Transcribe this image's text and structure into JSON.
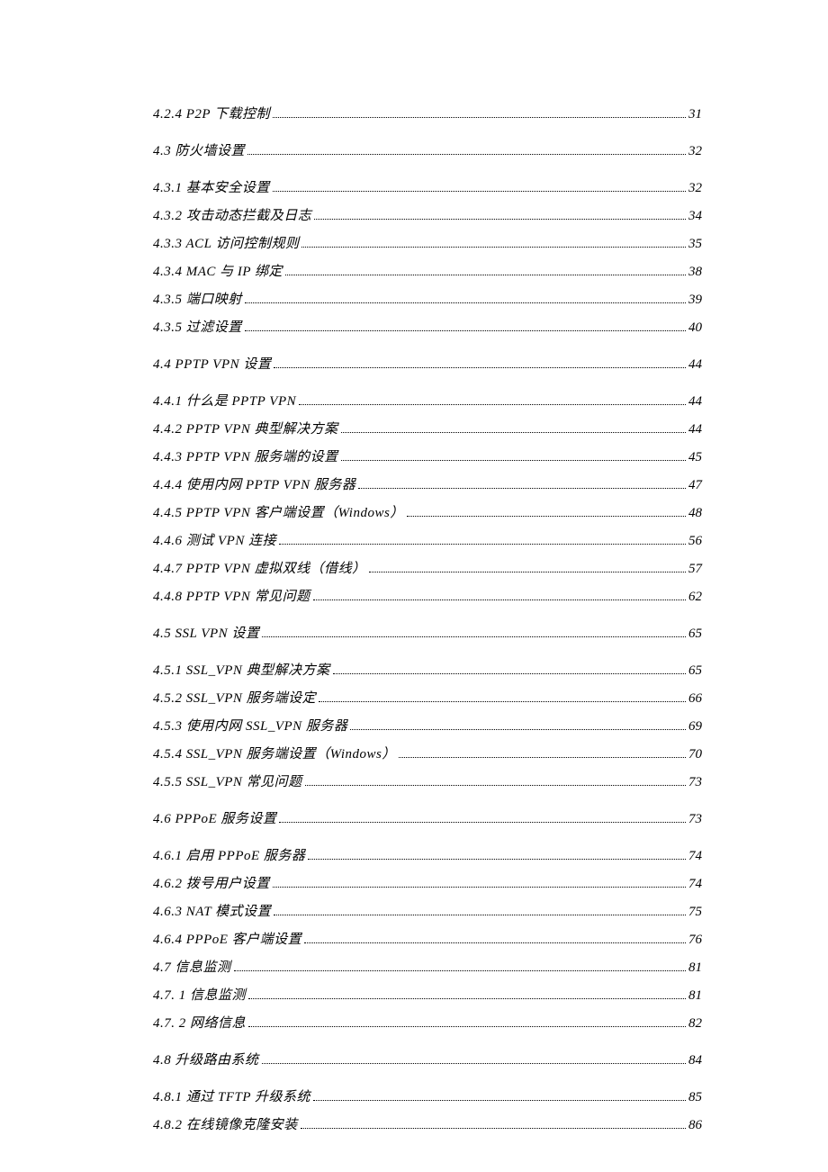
{
  "toc": [
    {
      "label": "4.2.4 P2P 下载控制",
      "page": "31",
      "gapAfter": "group"
    },
    {
      "label": "4.3  防火墙设置",
      "page": "32",
      "gapAfter": "group"
    },
    {
      "label": "4.3.1 基本安全设置",
      "page": "32",
      "gapAfter": "line"
    },
    {
      "label": "4.3.2 攻击动态拦截及日志",
      "page": "34",
      "gapAfter": "line"
    },
    {
      "label": "4.3.3 ACL 访问控制规则",
      "page": "35",
      "gapAfter": "line"
    },
    {
      "label": "4.3.4 MAC 与 IP 绑定",
      "page": "38",
      "gapAfter": "line"
    },
    {
      "label": "4.3.5 端口映射",
      "page": "39",
      "gapAfter": "line"
    },
    {
      "label": "4.3.5 过滤设置",
      "page": "40",
      "gapAfter": "group"
    },
    {
      "label": "4.4  PPTP VPN 设置",
      "page": "44",
      "gapAfter": "group"
    },
    {
      "label": "4.4.1 什么是 PPTP VPN",
      "page": "44",
      "gapAfter": "line"
    },
    {
      "label": "4.4.2 PPTP VPN 典型解决方案",
      "page": "44",
      "gapAfter": "line"
    },
    {
      "label": "4.4.3 PPTP VPN 服务端的设置",
      "page": "45",
      "gapAfter": "line"
    },
    {
      "label": "4.4.4 使用内网 PPTP VPN 服务器",
      "page": "47",
      "gapAfter": "line"
    },
    {
      "label": "4.4.5 PPTP VPN 客户端设置（Windows）",
      "page": "48",
      "gapAfter": "line"
    },
    {
      "label": "4.4.6 测试 VPN 连接",
      "page": "56",
      "gapAfter": "line"
    },
    {
      "label": "4.4.7 PPTP VPN 虚拟双线（借线）",
      "page": "57",
      "gapAfter": "line"
    },
    {
      "label": "4.4.8 PPTP VPN 常见问题",
      "page": "62",
      "gapAfter": "group"
    },
    {
      "label": "4.5  SSL VPN 设置",
      "page": "65",
      "gapAfter": "group"
    },
    {
      "label": "4.5.1 SSL_VPN 典型解决方案",
      "page": "65",
      "gapAfter": "line"
    },
    {
      "label": "4.5.2 SSL_VPN 服务端设定",
      "page": "66",
      "gapAfter": "line"
    },
    {
      "label": "4.5.3 使用内网 SSL_VPN 服务器",
      "page": "69",
      "gapAfter": "line"
    },
    {
      "label": "4.5.4 SSL_VPN 服务端设置（Windows）",
      "page": "70",
      "gapAfter": "line"
    },
    {
      "label": "4.5.5 SSL_VPN 常见问题",
      "page": "73",
      "gapAfter": "group"
    },
    {
      "label": "4.6  PPPoE 服务设置",
      "page": "73",
      "gapAfter": "group"
    },
    {
      "label": "4.6.1 启用 PPPoE 服务器",
      "page": "74",
      "gapAfter": "line"
    },
    {
      "label": "4.6.2 拨号用户设置",
      "page": "74",
      "gapAfter": "line"
    },
    {
      "label": "4.6.3 NAT 模式设置",
      "page": "75",
      "gapAfter": "line"
    },
    {
      "label": "4.6.4 PPPoE 客户端设置",
      "page": "76",
      "gapAfter": "line"
    },
    {
      "label": "4.7 信息监测",
      "page": "81",
      "gapAfter": "line"
    },
    {
      "label": "4.7. 1 信息监测",
      "page": "81",
      "gapAfter": "line"
    },
    {
      "label": "4.7. 2 网络信息",
      "page": "82",
      "gapAfter": "group"
    },
    {
      "label": "4.8 升级路由系统",
      "page": "84",
      "gapAfter": "group"
    },
    {
      "label": "4.8.1 通过 TFTP 升级系统",
      "page": "85",
      "gapAfter": "line"
    },
    {
      "label": "4.8.2 在线镜像克隆安装",
      "page": "86",
      "gapAfter": "none"
    }
  ]
}
